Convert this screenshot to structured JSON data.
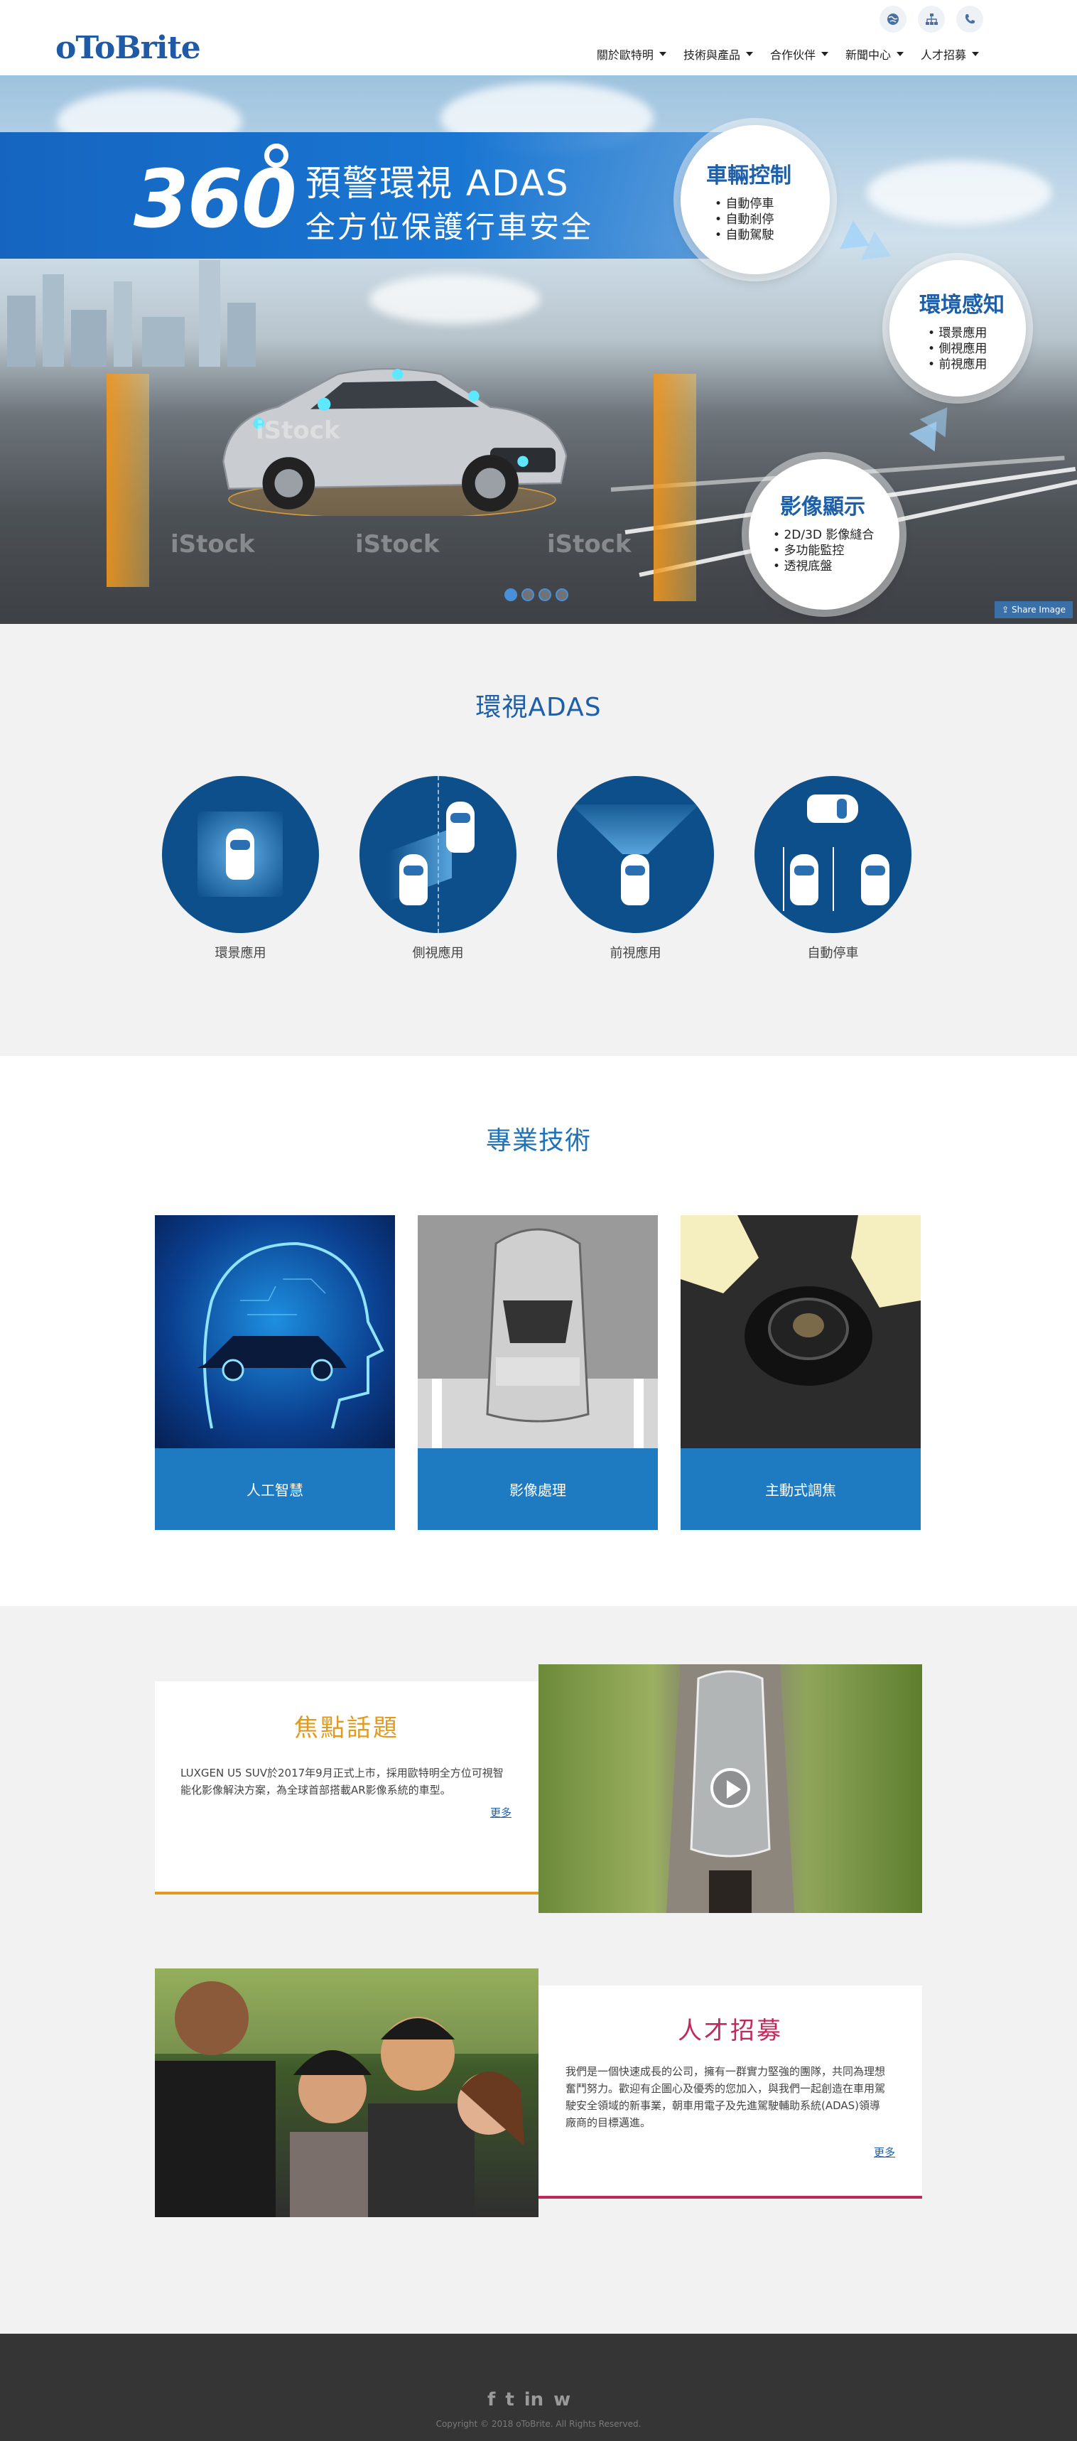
{
  "header": {
    "logo": "oToBrite",
    "nav": [
      {
        "label": "關於歐特明"
      },
      {
        "label": "技術與產品"
      },
      {
        "label": "合作伙伴"
      },
      {
        "label": "新聞中心"
      },
      {
        "label": "人才招募"
      }
    ],
    "top_icons": [
      "globe-icon",
      "sitemap-icon",
      "phone-icon"
    ]
  },
  "hero": {
    "number": "360",
    "title_line1": "預警環視 ADAS",
    "title_line2": "全方位保護行車安全",
    "bubbles": [
      {
        "title": "車輛控制",
        "items": [
          "自動停車",
          "自動剎停",
          "自動駕駛"
        ]
      },
      {
        "title": "環境感知",
        "items": [
          "環景應用",
          "側視應用",
          "前視應用"
        ]
      },
      {
        "title": "影像顯示",
        "items": [
          "2D/3D 影像縫合",
          "多功能監控",
          "透視底盤"
        ]
      }
    ],
    "slide_count": 4,
    "active_slide": 1,
    "share_label": "Share Image",
    "watermarks": [
      "iStock",
      "iStock",
      "iStock",
      "iStock"
    ]
  },
  "adas": {
    "title": "環視ADAS",
    "items": [
      {
        "label": "環景應用"
      },
      {
        "label": "側視應用"
      },
      {
        "label": "前視應用"
      },
      {
        "label": "自動停車"
      }
    ]
  },
  "tech": {
    "title": "專業技術",
    "cards": [
      {
        "label": "人工智慧"
      },
      {
        "label": "影像處理"
      },
      {
        "label": "主動式調焦"
      }
    ]
  },
  "news": {
    "focus": {
      "title": "焦點話題",
      "text": "LUXGEN U5 SUV於2017年9月正式上市，採用歐特明全方位可視智能化影像解決方案，為全球首部搭載AR影像系統的車型。",
      "more": "更多",
      "accent": "#e09a1e"
    },
    "careers": {
      "title": "人才招募",
      "text": "我們是一個快速成長的公司，擁有一群實力堅強的團隊，共同為理想奮鬥努力。歡迎有企圖心及優秀的您加入，與我們一起創造在車用駕駛安全領域的新事業，朝車用電子及先進駕駛輔助系統(ADAS)領導廠商的目標邁進。",
      "more": "更多",
      "accent": "#c2285e"
    }
  },
  "footer": {
    "social": [
      {
        "icon": "facebook-icon",
        "glyph": "f"
      },
      {
        "icon": "twitter-icon",
        "glyph": "t"
      },
      {
        "icon": "linkedin-icon",
        "glyph": "in"
      },
      {
        "icon": "weibo-icon",
        "glyph": "w"
      }
    ],
    "copyright": "Copyright © 2018 oToBrite. All Rights Reserved."
  }
}
